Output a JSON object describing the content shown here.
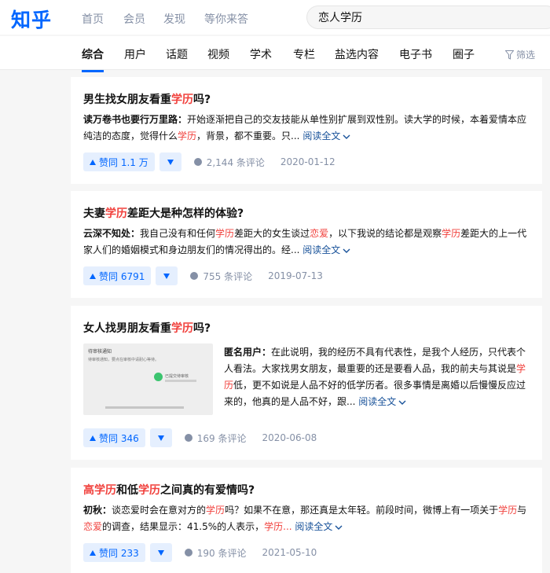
{
  "header": {
    "logo": "知乎",
    "nav": [
      "首页",
      "会员",
      "发现",
      "等你来答"
    ],
    "search_value": "恋人学历"
  },
  "tabs": [
    "综合",
    "用户",
    "话题",
    "视频",
    "学术",
    "专栏",
    "盐选内容",
    "电子书",
    "圈子"
  ],
  "filter_label": "筛选",
  "colors": {
    "brand": "#0066ff",
    "highlight": "#f1403c",
    "link": "#175199",
    "muted": "#8590a6"
  },
  "read_more": "阅读全文",
  "results": [
    {
      "title": [
        "男生找女朋友看重",
        "学历",
        "吗?"
      ],
      "author": "读万卷书也要行万里路",
      "excerpt": [
        "开始逐渐把自己的交友技能从单性别扩展到双性别。读大学的时候，本着爱情本应纯洁的态度，觉得什么",
        "学历",
        "，背景，都不重要。只..."
      ],
      "votes": "赞同 1.1 万",
      "comments": "2,144 条评论",
      "date": "2020-01-12"
    },
    {
      "title": [
        "夫妻",
        "学历",
        "差距大是种怎样的体验?"
      ],
      "author": "云深不知处",
      "excerpt": [
        "我自己没有和任何",
        "学历",
        "差距大的女生谈过",
        "恋爱",
        "，以下我说的结论都是观察",
        "学历",
        "差距大的上一代家人们的婚姻模式和身边朋友们的情况得出的。经..."
      ],
      "votes": "赞同 6791",
      "comments": "755 条评论",
      "date": "2019-07-13"
    },
    {
      "title": [
        "女人找男朋友看重",
        "学历",
        "吗?"
      ],
      "author": "匿名用户",
      "excerpt": [
        "在此说明，我的经历不具有代表性，是我个人经历，只代表个人看法。大家找男女朋友，最重要的还是要看人品，我的前夫与其说是",
        "学历",
        "低，更不如说是人品不好的低学历者。很多事情是离婚以后慢慢反应过来的，他真的是人品不好，跟..."
      ],
      "thumb_text": [
        "待审核通知",
        "待审核通知，要点在审核中请耐心等待。",
        "已提交待审核"
      ],
      "votes": "赞同 346",
      "comments": "169 条评论",
      "date": "2020-06-08"
    },
    {
      "title": [
        "高",
        "学历",
        "和低",
        "学历",
        "之间真的有爱情吗?"
      ],
      "author": "初秋",
      "excerpt": [
        "谈恋爱时会在意对方的",
        "学历",
        "吗？如果不在意，那还真是太年轻。前段时间，微博上有一项关于",
        "学历",
        "与",
        "恋爱",
        "的调查，结果显示：41.5%的人表示，",
        "学历..."
      ],
      "votes": "赞同 233",
      "comments": "190 条评论",
      "date": "2021-05-10"
    }
  ]
}
